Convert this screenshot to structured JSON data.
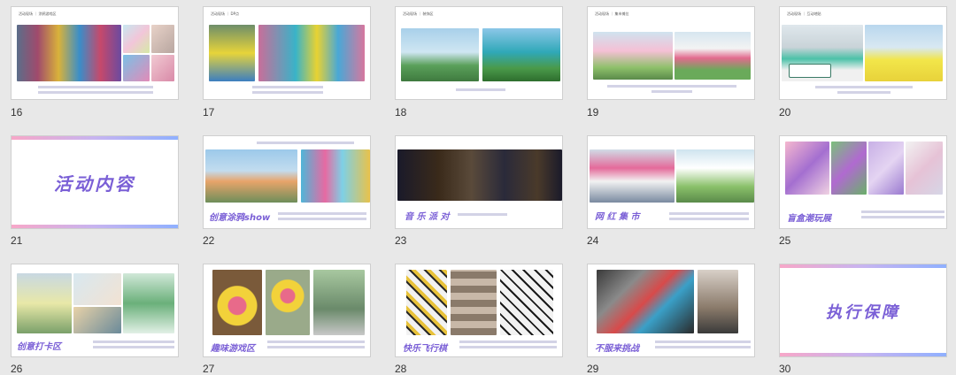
{
  "colors": {
    "background": "#e8e8e8",
    "accent_purple": "#7a5fd6",
    "accent_pink": "#f7a7c8",
    "accent_blue": "#8fb0ff",
    "caption": "#6a6aa8"
  },
  "slides": [
    {
      "number": "16",
      "header": "活动现场 ｜ 涂鸦游戏区"
    },
    {
      "number": "17",
      "header": "活动现场 ｜ DP点"
    },
    {
      "number": "18",
      "header": "活动现场 ｜ 装饰区"
    },
    {
      "number": "19",
      "header": "活动现场 ｜ 集市摊位"
    },
    {
      "number": "20",
      "header": "活动现场 ｜ 互动地贴"
    },
    {
      "number": "21",
      "title": "活动内容"
    },
    {
      "number": "22",
      "subtitle": "创意涂鸦show"
    },
    {
      "number": "23",
      "subtitle": "音 乐 派 对"
    },
    {
      "number": "24",
      "subtitle": "网 红 集 市"
    },
    {
      "number": "25",
      "subtitle": "盲盒潮玩展"
    },
    {
      "number": "26",
      "subtitle": "创意打卡区"
    },
    {
      "number": "27",
      "subtitle": "趣味游戏区"
    },
    {
      "number": "28",
      "subtitle": "快乐飞行棋"
    },
    {
      "number": "29",
      "subtitle": "不服来挑战"
    },
    {
      "number": "30",
      "title": "执行保障"
    }
  ]
}
